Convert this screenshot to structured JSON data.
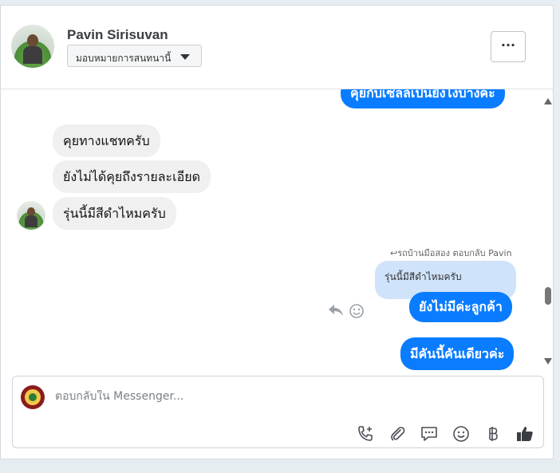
{
  "header": {
    "contact_name": "Pavin Sirisuvan",
    "assign_label": "มอบหมายการสนทนานี้",
    "more_label": "···"
  },
  "messages": {
    "top_partial": "คุยกับเซลล์เป็นยังไงบ้างคะ",
    "incoming": [
      "คุยทางแชทครับ",
      "ยังไม่ได้คุยถึงรายละเอียด",
      "รุ่นนี้มีสีดำไหมครับ"
    ],
    "reply_meta": "รถบ้านมือสอง ตอบกลับ Pavin",
    "quoted_text": "รุ่นนี้มีสีดำไหมครับ",
    "outgoing_reply": "ยังไม่มีค่ะลูกค้า",
    "outgoing_last": "มีคันนี้คันเดียวค่ะ"
  },
  "composer": {
    "placeholder": "ตอบกลับใน Messenger..."
  },
  "colors": {
    "accent": "#0a7cff",
    "quoted_bg": "#cfe3fb",
    "incoming_bg": "#f0f0f0"
  }
}
